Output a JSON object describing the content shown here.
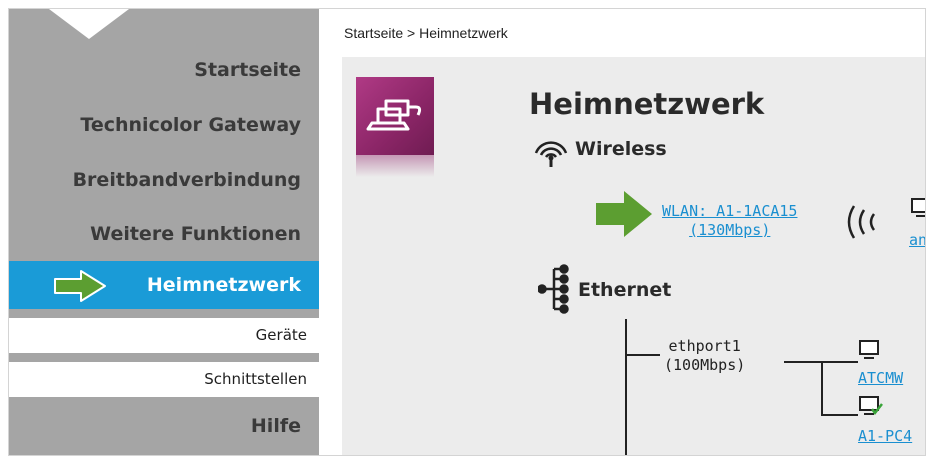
{
  "breadcrumb": "Startseite > Heimnetzwerk",
  "sidebar": {
    "items": [
      {
        "label": "Startseite"
      },
      {
        "label": "Technicolor Gateway"
      },
      {
        "label": "Breitbandverbindung"
      },
      {
        "label": "Weitere Funktionen"
      },
      {
        "label": "Heimnetzwerk"
      },
      {
        "label": "Geräte"
      },
      {
        "label": "Schnittstellen"
      },
      {
        "label": "Hilfe"
      }
    ]
  },
  "page": {
    "title": "Heimnetzwerk",
    "wireless": {
      "label": "Wireless",
      "wlan_line1": "WLAN: A1-1ACA15",
      "wlan_line2": "(130Mbps)",
      "device_partial": "anc"
    },
    "ethernet": {
      "label": "Ethernet",
      "port_line1": "ethport1",
      "port_line2": "(100Mbps)",
      "device1": "ATCMW",
      "device2": "A1-PC4"
    }
  },
  "colors": {
    "active_nav": "#1a9bd7",
    "sidebar": "#a5a5a5",
    "arrow_green": "#5c9e31",
    "tile": "#9a2e72",
    "link": "#1a8fd0"
  },
  "icons": [
    "home-network-icon",
    "wifi-icon",
    "tree-icon",
    "arrow-icon",
    "computer-icon"
  ]
}
